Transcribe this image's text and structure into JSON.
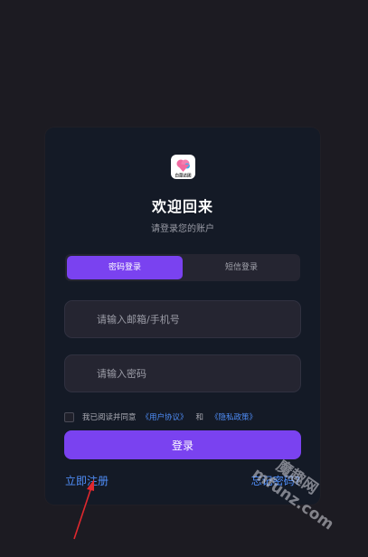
{
  "app": {
    "logo_text": "白菜达团"
  },
  "header": {
    "title": "欢迎回来",
    "subtitle": "请登录您的账户"
  },
  "tabs": [
    {
      "label": "密码登录",
      "active": true
    },
    {
      "label": "短信登录",
      "active": false
    }
  ],
  "form": {
    "email_placeholder": "请输入邮箱/手机号",
    "email_value": "",
    "password_placeholder": "请输入密码",
    "password_value": ""
  },
  "agreement": {
    "checked": false,
    "prefix": "我已阅读并同意",
    "user_agreement": "《用户协议》",
    "and": "和",
    "privacy_policy": "《隐私政策》"
  },
  "actions": {
    "login_label": "登录",
    "register_label": "立即注册",
    "forgot_label": "忘记密码?"
  },
  "watermark": {
    "site": "mfunz.com",
    "brand": "魔趣网"
  },
  "colors": {
    "page_bg": "#1c1b22",
    "card_bg": "#141a26",
    "accent": "#7a42f0",
    "link": "#4f8df7",
    "arrow": "#e0282e"
  },
  "icons": {
    "logo": "app-logo-icon",
    "annotation_arrow": "red-arrow-icon"
  }
}
